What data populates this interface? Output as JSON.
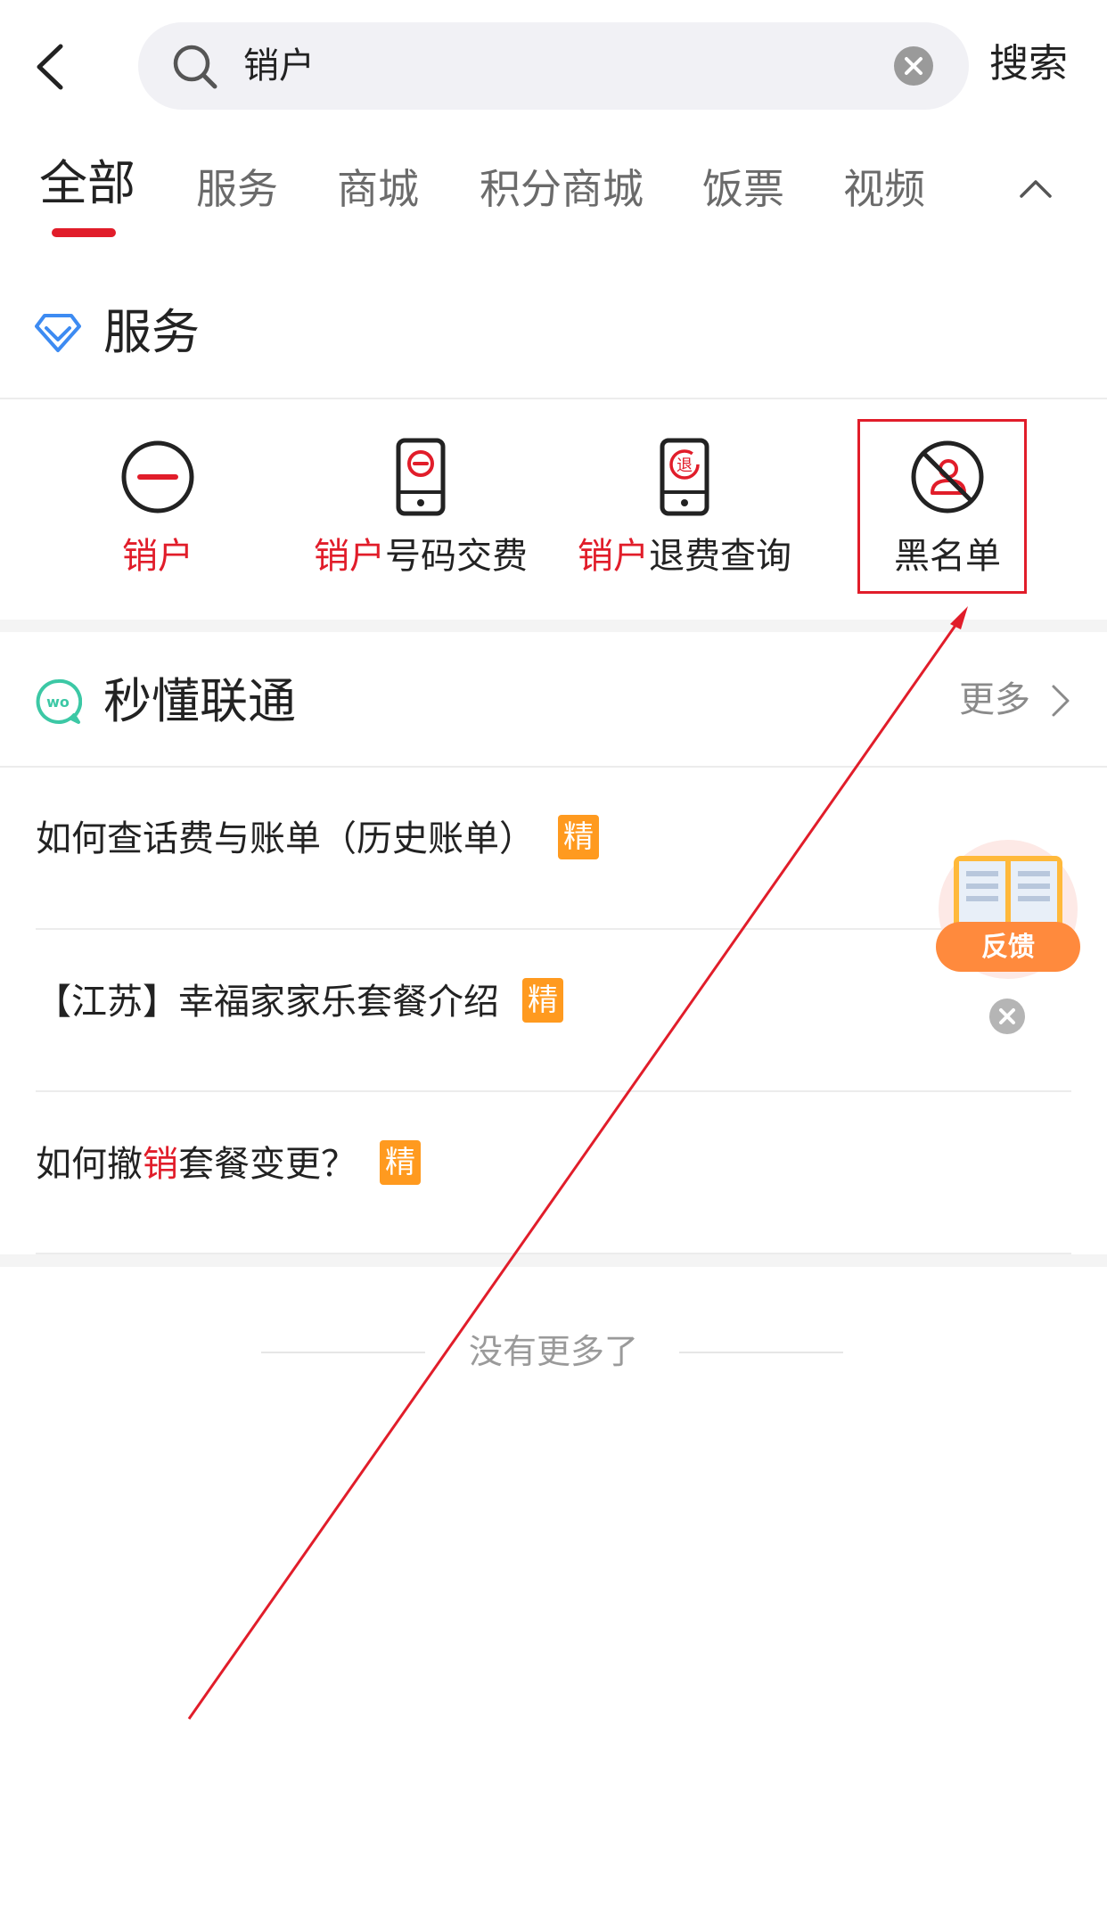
{
  "search": {
    "query": "销户",
    "submit_label": "搜索"
  },
  "tabs": [
    {
      "label": "全部",
      "active": true
    },
    {
      "label": "服务"
    },
    {
      "label": "商城"
    },
    {
      "label": "积分商城"
    },
    {
      "label": "饭票"
    },
    {
      "label": "视频"
    }
  ],
  "services_section": {
    "title": "服务",
    "items": [
      {
        "label_highlight": "销户",
        "label_rest": "",
        "icon": "minus-circle-icon"
      },
      {
        "label_highlight": "销户",
        "label_rest": "号码交费",
        "icon": "phone-cancel-icon"
      },
      {
        "label_highlight": "销户",
        "label_rest": "退费查询",
        "icon": "phone-refund-icon",
        "icon_text": "退"
      },
      {
        "label_highlight": "",
        "label_rest": "黑名单",
        "icon": "blocked-user-icon"
      }
    ]
  },
  "knowledge_section": {
    "title": "秒懂联通",
    "logo_text": "wo",
    "more_label": "更多",
    "articles": [
      {
        "pre": "如何查话费与账单（历史账单）",
        "hl": "",
        "post": "",
        "badge": "精"
      },
      {
        "pre": "【江苏】幸福家家乐套餐介绍",
        "hl": "",
        "post": "",
        "badge": "精"
      },
      {
        "pre": "如何撤",
        "hl": "销",
        "post": "套餐变更？",
        "badge": "精"
      }
    ]
  },
  "footer_text": "没有更多了",
  "feedback_widget": {
    "label": "反馈"
  },
  "colors": {
    "accent_red": "#e11d2a",
    "badge_orange": "#ff9a1f",
    "service_icon_blue": "#3d8bf2",
    "wo_green": "#3cc8a5"
  }
}
